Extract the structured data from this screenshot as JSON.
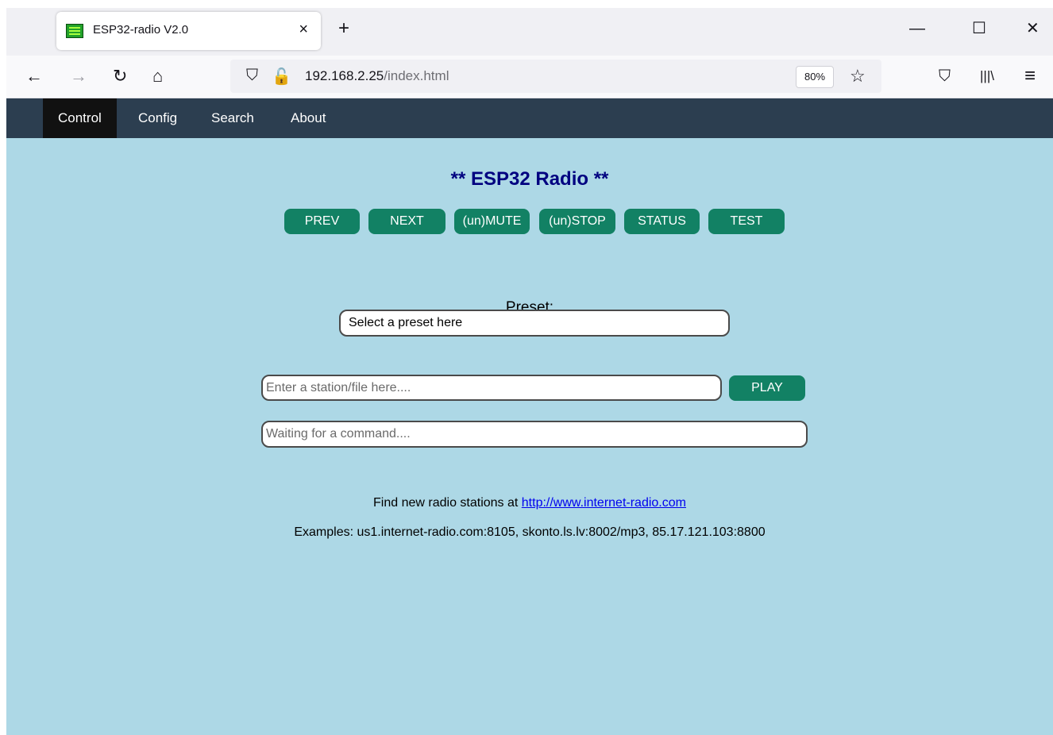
{
  "browser": {
    "tab_title": "ESP32-radio V2.0",
    "tab_close": "×",
    "new_tab": "+",
    "window_controls": {
      "minimize": "—",
      "maximize": "☐",
      "close": "✕"
    },
    "nav": {
      "back": "←",
      "forward": "→",
      "reload": "↻",
      "home": "⌂"
    },
    "url_host": "192.168.2.25",
    "url_path": "/index.html",
    "zoom": "80%",
    "bookmark_star": "☆",
    "pocket_icon": "⛉",
    "library_icon": "|||\\",
    "menu_icon": "≡",
    "shield_icon": "⛉",
    "lock_icon": "🔓"
  },
  "navbar": {
    "items": [
      {
        "label": "Control",
        "active": true
      },
      {
        "label": "Config"
      },
      {
        "label": "Search"
      },
      {
        "label": "About"
      }
    ]
  },
  "main": {
    "title": "** ESP32 Radio **",
    "buttons": [
      "PREV",
      "NEXT",
      "(un)MUTE",
      "(un)STOP",
      "STATUS",
      "TEST"
    ],
    "preset_label": "Preset:",
    "preset_selected": "Select a preset here",
    "station_placeholder": "Enter a station/file here....",
    "play_label": "PLAY",
    "status_placeholder": "Waiting for a command....",
    "find_text": "Find new radio stations at ",
    "find_link": "http://www.internet-radio.com",
    "examples": "Examples: us1.internet-radio.com:8105, skonto.ls.lv:8002/mp3, 85.17.121.103:8800"
  },
  "colors": {
    "page_bg": "#add8e6",
    "navbar_bg": "#2c3e50",
    "button_bg": "#128164",
    "title": "#000080"
  }
}
